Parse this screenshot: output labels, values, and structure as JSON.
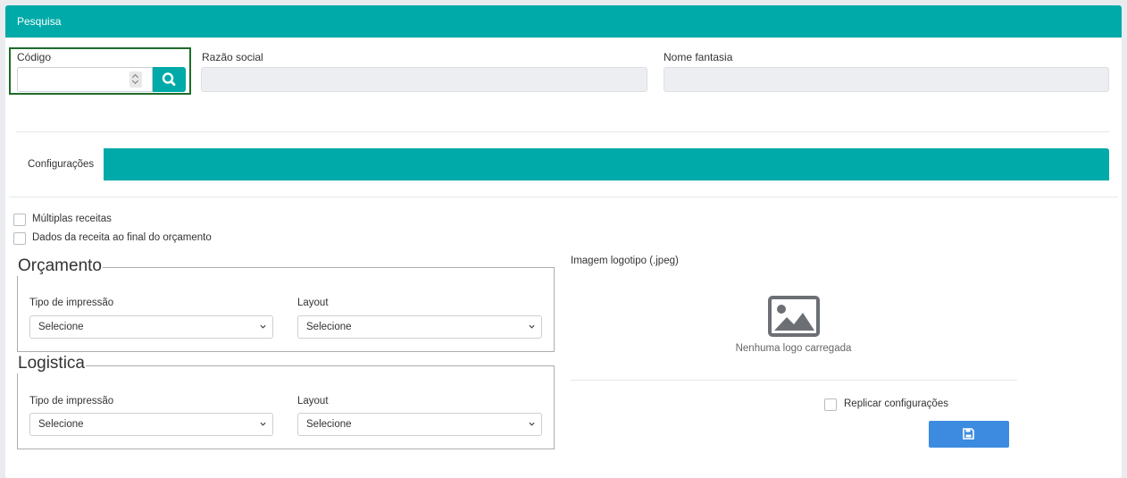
{
  "header": {
    "title": "Pesquisa"
  },
  "search": {
    "codigo_label": "Código",
    "codigo_value": "",
    "razao_label": "Razão social",
    "razao_value": "",
    "fantasia_label": "Nome fantasia",
    "fantasia_value": ""
  },
  "tabs": [
    {
      "label": "Configurações",
      "active": true
    }
  ],
  "options": {
    "multiplas_receitas": {
      "label": "Múltiplas receitas",
      "checked": false
    },
    "dados_receita": {
      "label": "Dados da receita ao final do orçamento",
      "checked": false
    }
  },
  "orcamento": {
    "legend": "Orçamento",
    "tipo_label": "Tipo de impressão",
    "tipo_value": "Selecione",
    "layout_label": "Layout",
    "layout_value": "Selecione"
  },
  "logistica": {
    "legend": "Logistica",
    "tipo_label": "Tipo de impressão",
    "tipo_value": "Selecione",
    "layout_label": "Layout",
    "layout_value": "Selecione"
  },
  "logo": {
    "label": "Imagem logotipo (.jpeg)",
    "empty_text": "Nenhuma logo carregada",
    "icon": "image-icon"
  },
  "replicar": {
    "label": "Replicar configurações",
    "checked": false
  },
  "save_button": {
    "icon": "save-icon"
  },
  "colors": {
    "teal": "#00aaa8",
    "save_blue": "#3c8be0",
    "highlight_green": "#1e6b2b"
  }
}
